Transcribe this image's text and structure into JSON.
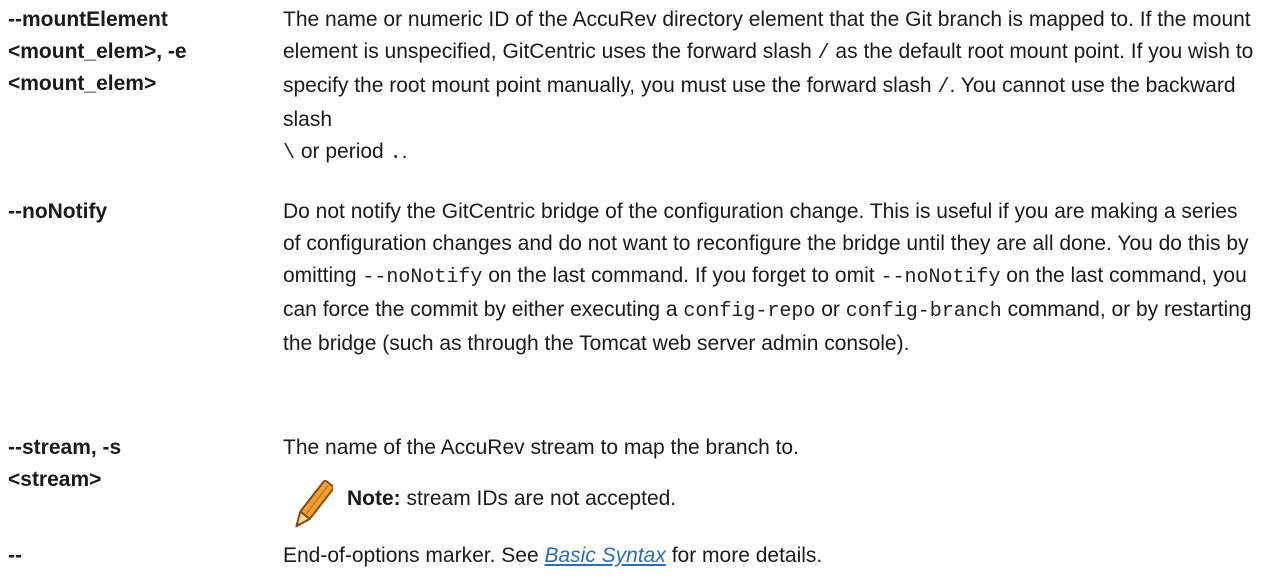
{
  "rows": {
    "mount": {
      "term": [
        "--mountElement",
        "<mount_elem>, -e",
        "<mount_elem>"
      ],
      "desc": {
        "t1": "The name or numeric ID of the AccuRev directory element that the Git branch is mapped to. If the mount element is unspecified, GitCentric uses the forward slash ",
        "c1": "/",
        "t2": " as the default root mount point. If you wish to specify the root mount point manually, you must use the forward slash ",
        "c2": "/",
        "t3": ". You cannot use the backward slash",
        "c3": "\\",
        "t4": " or period ",
        "c4": ".",
        "t5": "."
      }
    },
    "nonotify": {
      "term": "--noNotify",
      "desc": {
        "t1": "Do not notify the GitCentric bridge of the configuration change. This is useful if you are making a series of configuration changes and do not want to reconfigure the bridge until they are all done. You do this by omitting ",
        "c1": "--noNotify",
        "t2": " on the last command. If you forget to omit ",
        "c2": "--noNotify",
        "t3": " on the last command, you can force the commit by either executing a ",
        "c3": "config-repo",
        "t4": " or ",
        "c4": "config-branch",
        "t5": " command, or by restarting the bridge (such as through the Tomcat web server admin console)."
      }
    },
    "stream": {
      "term": [
        "--stream, -s",
        "<stream>"
      ],
      "desc": "The name of the AccuRev stream to map the branch to.",
      "note_label": "Note:",
      "note_text": " stream IDs are not accepted."
    },
    "eoo": {
      "term": "--",
      "t1": "End-of-options marker. See ",
      "link": "Basic Syntax",
      "t2": " for more details."
    }
  },
  "colors": {
    "text": "#1a1a1a",
    "link": "#2a6ebb",
    "pencil_body": "#f0a030",
    "pencil_outline": "#8a4a10"
  },
  "icons": {
    "note": "pencil-icon"
  }
}
